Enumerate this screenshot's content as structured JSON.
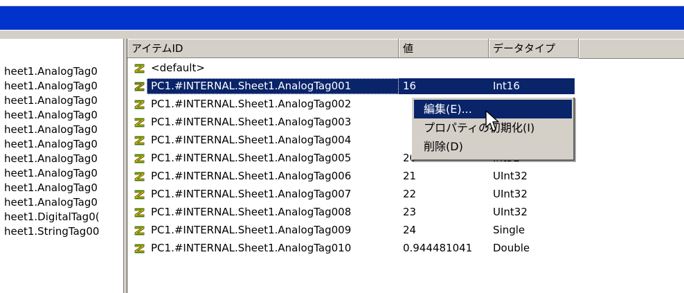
{
  "colors": {
    "titlebar": "#0033cc",
    "selection": "#0a246a",
    "face": "#d4d0c8"
  },
  "tree": {
    "items": [
      "heet1.AnalogTag0",
      "heet1.AnalogTag0",
      "heet1.AnalogTag0",
      "heet1.AnalogTag0",
      "heet1.AnalogTag0",
      "heet1.AnalogTag0",
      "heet1.AnalogTag0",
      "heet1.AnalogTag0",
      "heet1.AnalogTag0",
      "heet1.AnalogTag0",
      "heet1.DigitalTag0(",
      "heet1.StringTag00"
    ]
  },
  "list": {
    "columns": [
      "アイテムID",
      "値",
      "データタイプ"
    ],
    "rows": [
      {
        "id": "<default>",
        "value": "",
        "type": "",
        "icon": "tag-icon"
      },
      {
        "id": "PC1.#INTERNAL.Sheet1.AnalogTag001",
        "value": "16",
        "type": "Int16",
        "icon": "tag-icon"
      },
      {
        "id": "PC1.#INTERNAL.Sheet1.AnalogTag002",
        "value": "",
        "type": "",
        "icon": "tag-icon"
      },
      {
        "id": "PC1.#INTERNAL.Sheet1.AnalogTag003",
        "value": "",
        "type": "",
        "icon": "tag-icon"
      },
      {
        "id": "PC1.#INTERNAL.Sheet1.AnalogTag004",
        "value": "",
        "type": "",
        "icon": "tag-icon"
      },
      {
        "id": "PC1.#INTERNAL.Sheet1.AnalogTag005",
        "value": "20",
        "type": "Int32",
        "icon": "tag-icon"
      },
      {
        "id": "PC1.#INTERNAL.Sheet1.AnalogTag006",
        "value": "21",
        "type": "UInt32",
        "icon": "tag-icon"
      },
      {
        "id": "PC1.#INTERNAL.Sheet1.AnalogTag007",
        "value": "22",
        "type": "UInt32",
        "icon": "tag-icon"
      },
      {
        "id": "PC1.#INTERNAL.Sheet1.AnalogTag008",
        "value": "23",
        "type": "UInt32",
        "icon": "tag-icon"
      },
      {
        "id": "PC1.#INTERNAL.Sheet1.AnalogTag009",
        "value": "24",
        "type": "Single",
        "icon": "tag-icon"
      },
      {
        "id": "PC1.#INTERNAL.Sheet1.AnalogTag010",
        "value": "0.944481041",
        "type": "Double",
        "icon": "tag-icon"
      }
    ]
  },
  "context_menu": {
    "items": [
      "編集(E)...",
      "プロパティの初期化(I)",
      "削除(D)"
    ]
  }
}
